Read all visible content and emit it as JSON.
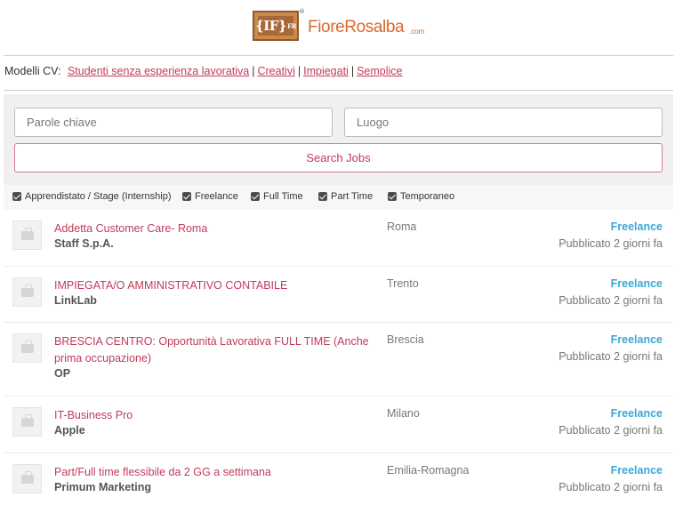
{
  "brand": {
    "mark_text": "{IF}",
    "mark_sup": "FR",
    "registered": "®",
    "name_part1": "Fiore",
    "name_part2": "Rosalba",
    "dotcom": ".com"
  },
  "cv_models": {
    "label": "Modelli CV:",
    "links": [
      "Studenti senza esperienza lavorativa",
      "Creativi",
      "Impiegati",
      "Semplice"
    ],
    "separator": "|"
  },
  "search": {
    "keywords_placeholder": "Parole chiave",
    "location_placeholder": "Luogo",
    "button_label": "Search Jobs"
  },
  "filters": [
    {
      "label": "Apprendistato / Stage (Internship)",
      "checked": true
    },
    {
      "label": "Freelance",
      "checked": true
    },
    {
      "label": "Full Time",
      "checked": true
    },
    {
      "label": "Part Time",
      "checked": true
    },
    {
      "label": "Temporaneo",
      "checked": true
    }
  ],
  "jobs": [
    {
      "title": "Addetta Customer Care- Roma",
      "company": "Staff S.p.A.",
      "location": "Roma",
      "type": "Freelance",
      "date": "Pubblicato 2 giorni fa"
    },
    {
      "title": "IMPIEGATA/O AMMINISTRATIVO CONTABILE",
      "company": "LinkLab",
      "location": "Trento",
      "type": "Freelance",
      "date": "Pubblicato 2 giorni fa"
    },
    {
      "title": "BRESCIA CENTRO: Opportunità Lavorativa FULL TIME (Anche prima occupazione)",
      "company": "OP",
      "location": "Brescia",
      "type": "Freelance",
      "date": "Pubblicato 2 giorni fa"
    },
    {
      "title": "IT-Business Pro",
      "company": "Apple",
      "location": "Milano",
      "type": "Freelance",
      "date": "Pubblicato 2 giorni fa"
    },
    {
      "title": "Part/Full time flessibile da 2 GG a settimana",
      "company": "Primum Marketing",
      "location": "Emilia-Romagna",
      "type": "Freelance",
      "date": "Pubblicato 2 giorni fa"
    }
  ],
  "colors": {
    "link": "#c23b5a",
    "job_type": "#3ba8d6",
    "brand_orange": "#d9692c"
  }
}
